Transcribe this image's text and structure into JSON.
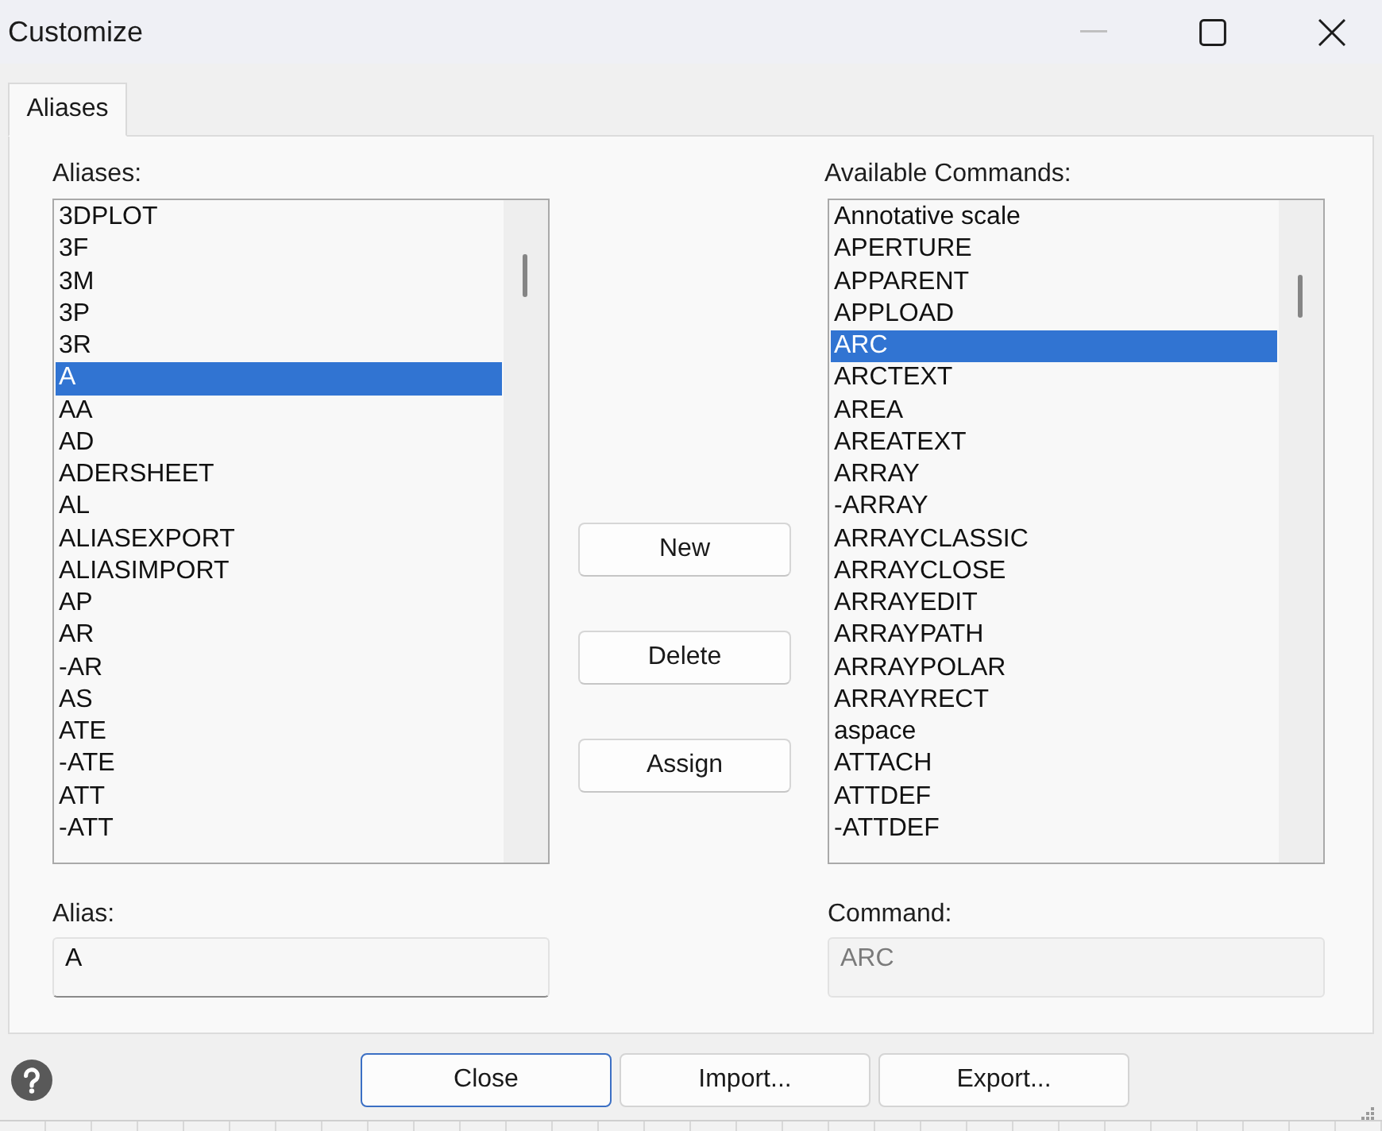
{
  "window": {
    "title": "Customize",
    "controls": [
      {
        "kind": "minimize",
        "disabled": true
      },
      {
        "kind": "maximize",
        "disabled": false
      },
      {
        "kind": "close",
        "disabled": false
      }
    ]
  },
  "tabs": [
    {
      "label": "Aliases",
      "selected": true
    }
  ],
  "aliases": {
    "label": "Aliases:",
    "items": [
      {
        "text": "3DPLOT",
        "selected": false
      },
      {
        "text": "3F",
        "selected": false
      },
      {
        "text": "3M",
        "selected": false
      },
      {
        "text": "3P",
        "selected": false
      },
      {
        "text": "3R",
        "selected": false
      },
      {
        "text": "A",
        "selected": true
      },
      {
        "text": "AA",
        "selected": false
      },
      {
        "text": "AD",
        "selected": false
      },
      {
        "text": "ADERSHEET",
        "selected": false
      },
      {
        "text": "AL",
        "selected": false
      },
      {
        "text": "ALIASEXPORT",
        "selected": false
      },
      {
        "text": "ALIASIMPORT",
        "selected": false
      },
      {
        "text": "AP",
        "selected": false
      },
      {
        "text": "AR",
        "selected": false
      },
      {
        "text": "-AR",
        "selected": false
      },
      {
        "text": "AS",
        "selected": false
      },
      {
        "text": "ATE",
        "selected": false
      },
      {
        "text": "-ATE",
        "selected": false
      },
      {
        "text": "ATT",
        "selected": false
      },
      {
        "text": "-ATT",
        "selected": false
      }
    ]
  },
  "actions": [
    {
      "label": "New"
    },
    {
      "label": "Delete"
    },
    {
      "label": "Assign"
    }
  ],
  "commands": {
    "label": "Available Commands:",
    "items": [
      {
        "text": "Annotative scale",
        "selected": false
      },
      {
        "text": "APERTURE",
        "selected": false
      },
      {
        "text": "APPARENT",
        "selected": false
      },
      {
        "text": "APPLOAD",
        "selected": false
      },
      {
        "text": "ARC",
        "selected": true
      },
      {
        "text": "ARCTEXT",
        "selected": false
      },
      {
        "text": "AREA",
        "selected": false
      },
      {
        "text": "AREATEXT",
        "selected": false
      },
      {
        "text": "ARRAY",
        "selected": false
      },
      {
        "text": "-ARRAY",
        "selected": false
      },
      {
        "text": "ARRAYCLASSIC",
        "selected": false
      },
      {
        "text": "ARRAYCLOSE",
        "selected": false
      },
      {
        "text": "ARRAYEDIT",
        "selected": false
      },
      {
        "text": "ARRAYPATH",
        "selected": false
      },
      {
        "text": "ARRAYPOLAR",
        "selected": false
      },
      {
        "text": "ARRAYRECT",
        "selected": false
      },
      {
        "text": "aspace",
        "selected": false
      },
      {
        "text": "ATTACH",
        "selected": false
      },
      {
        "text": "ATTDEF",
        "selected": false
      },
      {
        "text": "-ATTDEF",
        "selected": false
      }
    ]
  },
  "alias_field": {
    "label": "Alias:",
    "value": "A",
    "disabled": false
  },
  "command_field": {
    "label": "Command:",
    "value": "ARC",
    "disabled": true
  },
  "buttons": [
    {
      "label": "Close",
      "focused": true
    },
    {
      "label": "Import...",
      "focused": false
    },
    {
      "label": "Export...",
      "focused": false
    }
  ]
}
